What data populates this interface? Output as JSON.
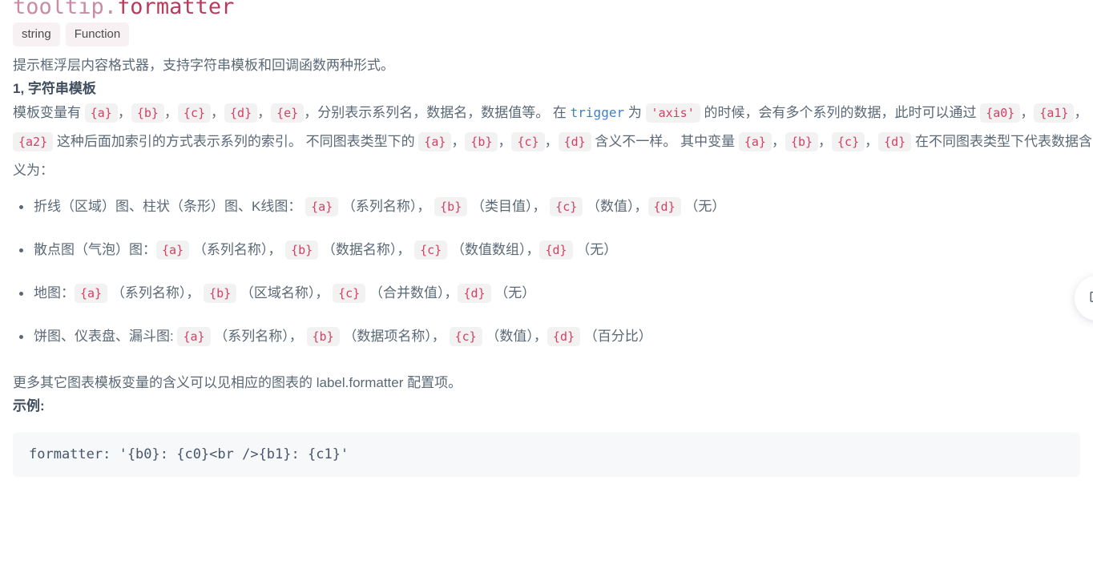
{
  "doc": {
    "title": {
      "parent": "tooltip.",
      "leaf": "formatter"
    },
    "types": [
      {
        "label": "string"
      },
      {
        "label": "Function"
      }
    ],
    "description": "提示框浮层内容格式器，支持字符串模板和回调函数两种形式。",
    "section_heading": "1, 字符串模板",
    "vars_paragraph": {
      "seg_1": "模板变量有 ",
      "tok_a": "{a}",
      "sep_1": "，",
      "tok_b": "{b}",
      "sep_2": "，",
      "tok_c": "{c}",
      "sep_3": "，",
      "tok_d": "{d}",
      "sep_4": "，",
      "tok_e": "{e}",
      "seg_2": "，分别表示系列名，数据名，数据值等。 在 ",
      "link_trigger": "trigger",
      "seg_3": " 为 ",
      "tok_axis": "'axis'",
      "seg_4": " 的时候，会有多个系列的数据，此时可以通过 ",
      "tok_a0": "{a0}",
      "sep_5": "，",
      "tok_a1": "{a1}",
      "sep_6": "，",
      "tok_a2": "{a2}",
      "seg_5": " 这种后面加索引的方式表示系列的索引。 不同图表类型下的 ",
      "tok_a_2": "{a}",
      "sep_7": "，",
      "tok_b_2": "{b}",
      "sep_8": "，",
      "tok_c_2": "{c}",
      "sep_9": "，",
      "tok_d_2": "{d}",
      "seg_6": " 含义不一样。 其中变量 ",
      "tok_a_3": "{a}",
      "sep_10": "，",
      "tok_b_3": "{b}",
      "sep_11": "，",
      "tok_c_3": "{c}",
      "sep_12": "，",
      "tok_d_3": "{d}",
      "seg_7": " 在不同图表类型下代表数据含义为："
    },
    "chart_types": [
      {
        "prefix": "折线（区域）图、柱状（条形）图、K线图：",
        "a": "{a}",
        "a_desc": "（系列名称），",
        "b": "{b}",
        "b_desc": "（类目值），",
        "c": "{c}",
        "c_desc": "（数值），",
        "d": "{d}",
        "d_desc": "（无）"
      },
      {
        "prefix": "散点图（气泡）图：",
        "a": "{a}",
        "a_desc": "（系列名称），",
        "b": "{b}",
        "b_desc": "（数据名称），",
        "c": "{c}",
        "c_desc": "（数值数组），",
        "d": "{d}",
        "d_desc": "（无）"
      },
      {
        "prefix": "地图：",
        "a": "{a}",
        "a_desc": "（系列名称），",
        "b": "{b}",
        "b_desc": "（区域名称），",
        "c": "{c}",
        "c_desc": "（合并数值），",
        "d": "{d}",
        "d_desc": "（无）"
      },
      {
        "prefix": "饼图、仪表盘、漏斗图:",
        "a": "{a}",
        "a_desc": "（系列名称），",
        "b": "{b}",
        "b_desc": "（数据项名称），",
        "c": "{c}",
        "c_desc": "（数值），",
        "d": "{d}",
        "d_desc": "（百分比）"
      }
    ],
    "more_info": "更多其它图表模板变量的含义可以见相应的图表的 label.formatter 配置项。",
    "example_heading": "示例:",
    "example_code": "formatter: '{b0}: {c0}<br />{b1}: {c1}'"
  },
  "floating_button": {
    "icon": "presentation-chart-icon"
  }
}
